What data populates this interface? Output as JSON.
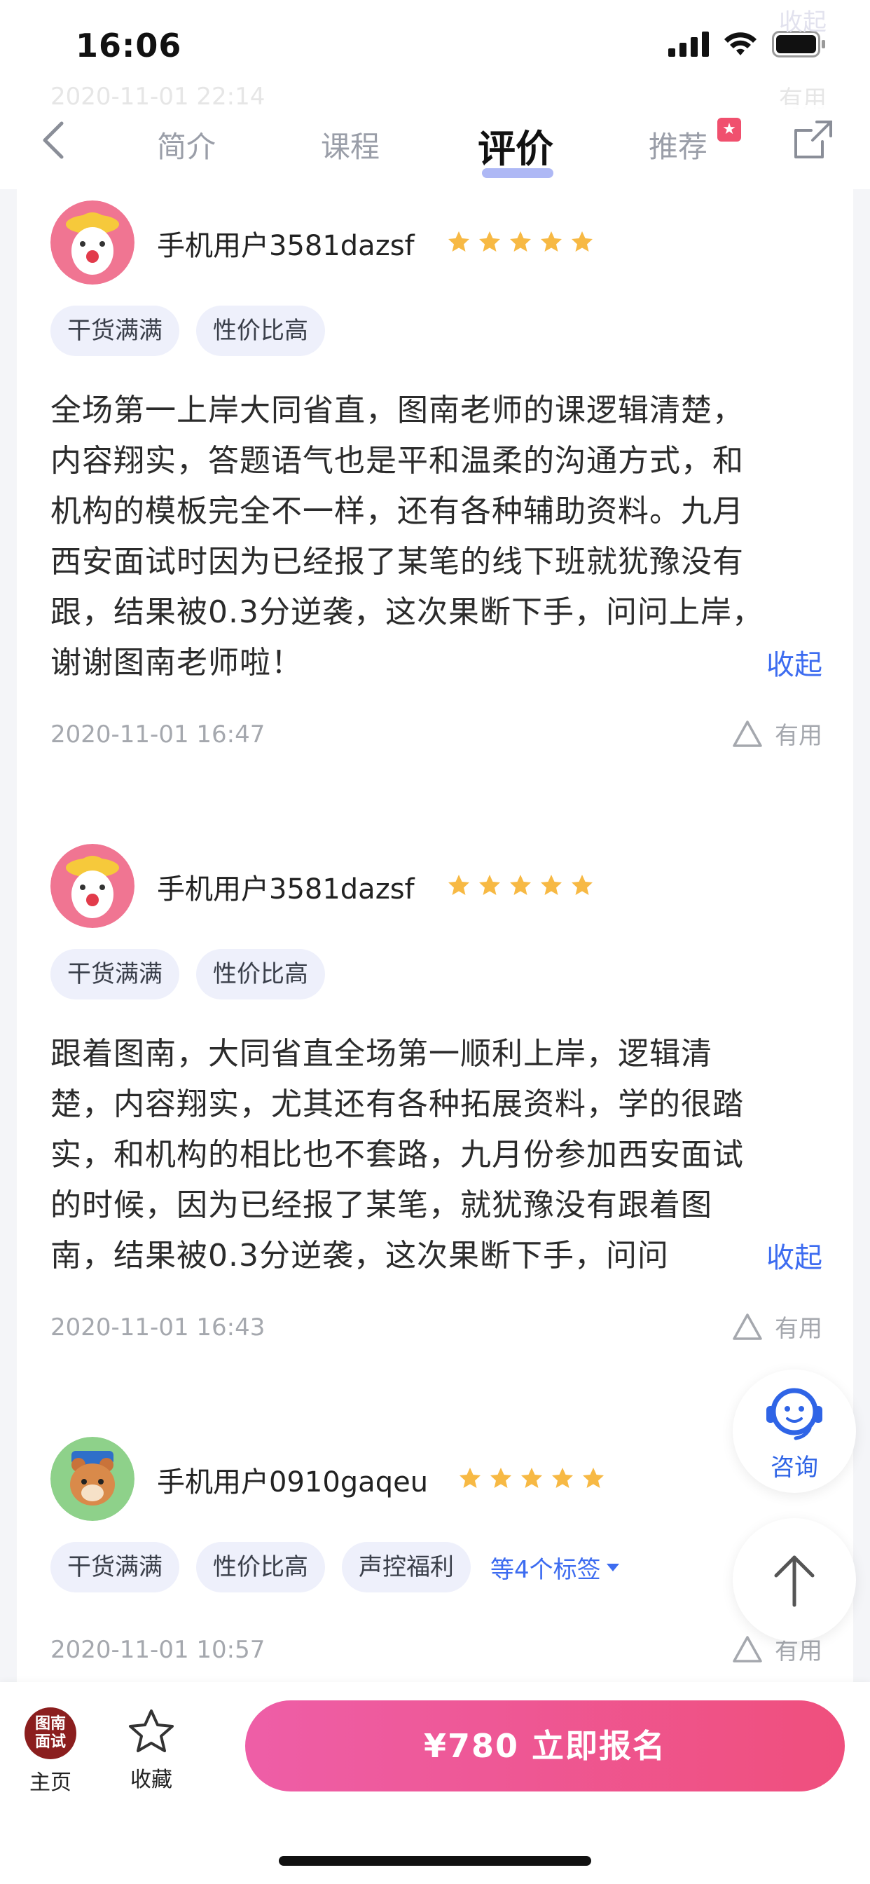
{
  "status": {
    "time": "16:06"
  },
  "ghost": {
    "collapse": "收起",
    "date": "2020-11-01 22:14",
    "useful": "有用"
  },
  "nav": {
    "tabs": [
      {
        "label": "简介"
      },
      {
        "label": "课程"
      },
      {
        "label": "评价"
      },
      {
        "label": "推荐"
      }
    ],
    "active_tab": "评价"
  },
  "reviews": [
    {
      "username": "手机用户3581dazsf",
      "rating": 5,
      "tags": [
        "干货满满",
        "性价比高"
      ],
      "lines": [
        "全场第一上岸大同省直，图南老师的课逻辑清楚，",
        "内容翔实，答题语气也是平和温柔的沟通方式，和",
        "机构的模板完全不一样，还有各种辅助资料。九月",
        "西安面试时因为已经报了某笔的线下班就犹豫没有",
        "跟，结果被0.3分逆袭，这次果断下手，问问上岸，",
        "谢谢图南老师啦！"
      ],
      "collapse_label": "收起",
      "date": "2020-11-01 16:47",
      "useful_label": "有用"
    },
    {
      "username": "手机用户3581dazsf",
      "rating": 5,
      "tags": [
        "干货满满",
        "性价比高"
      ],
      "lines": [
        "跟着图南，大同省直全场第一顺利上岸，逻辑清",
        "楚，内容翔实，尤其还有各种拓展资料，学的很踏",
        "实，和机构的相比也不套路，九月份参加西安面试",
        "的时候，因为已经报了某笔，就犹豫没有跟着图",
        "南，结果被0.3分逆袭，这次果断下手，问问"
      ],
      "collapse_label": "收起",
      "date": "2020-11-01 16:43",
      "useful_label": "有用"
    },
    {
      "username": "手机用户0910gaqeu",
      "rating": 5,
      "tags": [
        "干货满满",
        "性价比高",
        "声控福利"
      ],
      "more_tags": "等4个标签",
      "date": "2020-11-01 10:57",
      "useful_label": "有用"
    }
  ],
  "float": {
    "consult_label": "咨询"
  },
  "bottom": {
    "home_logo": "图南面试",
    "home_label": "主页",
    "fav_label": "收藏",
    "signup_label": "¥780  立即报名"
  },
  "colors": {
    "accent": "#3d6cf0",
    "star": "#f7b944",
    "button_start": "#ee5ea7",
    "button_end": "#ef4f7d"
  }
}
